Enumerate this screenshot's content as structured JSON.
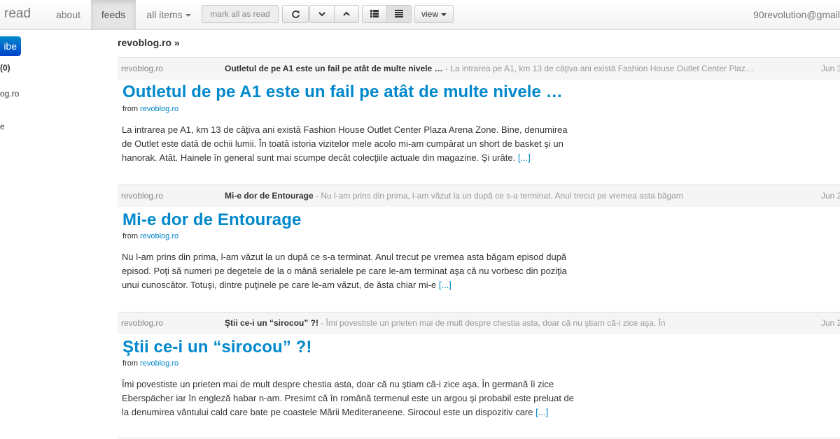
{
  "nav": {
    "brand": "read",
    "about": "about",
    "feeds": "feeds",
    "all_items": "all items",
    "mark_all_read": "mark all as read",
    "view": "view",
    "user": "90revolution@gmail"
  },
  "sidebar": {
    "subscribe_label": "ibe",
    "all_count": "(0)",
    "items": [
      {
        "label": "og.ro"
      },
      {
        "label": "e"
      }
    ]
  },
  "breadcrumb": "revoblog.ro »",
  "entries": [
    {
      "feed": "revoblog.ro",
      "title": "Outletul de pe A1 este un fail pe atât de multe nivele …",
      "summary": " - La intrarea pe A1, km 13 de câţiva ani există Fashion House Outlet Center Plaz…",
      "date": "Jun 3",
      "from_label": "from",
      "source": "revoblog.ro",
      "body": "La intrarea pe A1, km 13 de câţiva ani există Fashion House Outlet Center Plaza Arena Zone. Bine, denumirea de Outlet este dată de ochii lumii. În toată istoria vizitelor mele acolo mi-am cumpărat un short de basket şi un hanorak. Atât. Hainele în general sunt mai scumpe decât colecţiile actuale din magazine. Şi urâte.",
      "more": "[...]"
    },
    {
      "feed": "revoblog.ro",
      "title": "Mi-e dor de Entourage",
      "summary": " - Nu l-am prins din prima, l-am văzut la un după ce s-a terminat. Anul trecut pe vremea asta băgam",
      "date": "Jun 2",
      "from_label": "from",
      "source": "revoblog.ro",
      "body": "Nu l-am prins din prima, l-am văzut la un după ce s-a terminat. Anul trecut pe vremea asta băgam episod după episod. Poţi să numeri pe degetele de la o mână serialele pe care le-am terminat aşa că nu vorbesc din poziţia unui cunoscător. Totuşi, dintre puţinele pe care le-am văzut, de ăsta chiar mi-e",
      "more": "[...]"
    },
    {
      "feed": "revoblog.ro",
      "title": "Ştii ce-i un “sirocou” ?!",
      "summary": " - Îmi povestiste un prieten mai de mult despre chestia asta, doar că nu ştiam că-i zice aşa. În",
      "date": "Jun 2",
      "from_label": "from",
      "source": "revoblog.ro",
      "body": "Îmi povestiste un prieten mai de mult despre chestia asta, doar că nu ştiam că-i zice aşa. În germană îi zice Eberspächer iar în engleză habar n-am. Presimt că în română termenul este un argou şi probabil este preluat de la denumirea vântului cald care bate pe coastele Mării Mediteraneene. Sirocoul este un dispozitiv care",
      "more": "[...]"
    }
  ]
}
